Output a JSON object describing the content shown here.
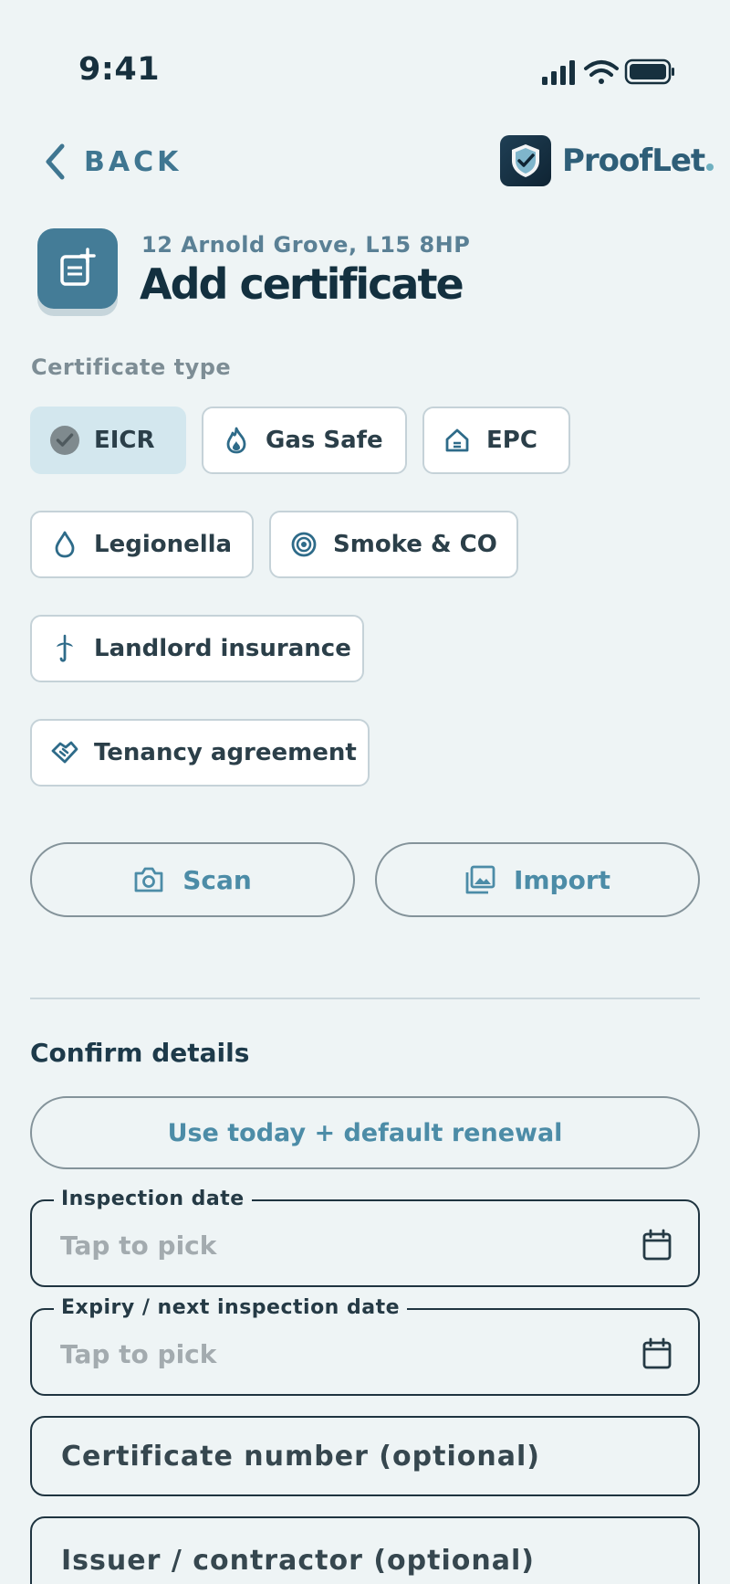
{
  "status_bar": {
    "time": "9:41",
    "icons": [
      "cellular-signal-icon",
      "wifi-icon",
      "battery-icon"
    ]
  },
  "header": {
    "back_label": "BACK",
    "brand_name": "ProofLet"
  },
  "page": {
    "address": "12 Arnold Grove, L15 8HP",
    "title": "Add certificate"
  },
  "certificate_type": {
    "label": "Certificate type",
    "options": [
      {
        "label": "EICR",
        "icon": "check-circle-icon",
        "selected": true
      },
      {
        "label": "Gas Safe",
        "icon": "flame-icon",
        "selected": false
      },
      {
        "label": "EPC",
        "icon": "house-energy-icon",
        "selected": false
      },
      {
        "label": "Legionella",
        "icon": "water-drop-icon",
        "selected": false
      },
      {
        "label": "Smoke & CO",
        "icon": "detector-icon",
        "selected": false
      },
      {
        "label": "Landlord insurance",
        "icon": "umbrella-icon",
        "selected": false
      },
      {
        "label": "Tenancy agreement",
        "icon": "handshake-icon",
        "selected": false
      }
    ]
  },
  "actions": {
    "scan_label": "Scan",
    "import_label": "Import"
  },
  "confirm": {
    "title": "Confirm details",
    "default_button": "Use today + default renewal",
    "inspection_date": {
      "label": "Inspection date",
      "placeholder": "Tap to pick"
    },
    "expiry_date": {
      "label": "Expiry / next inspection date",
      "placeholder": "Tap to pick"
    },
    "certificate_number_placeholder": "Certificate number (optional)",
    "issuer_placeholder": "Issuer / contractor (optional)"
  },
  "colors": {
    "background": "#eef4f5",
    "accent": "#447c97",
    "selected_chip": "#d3e7ee",
    "title_text": "#13303f"
  }
}
